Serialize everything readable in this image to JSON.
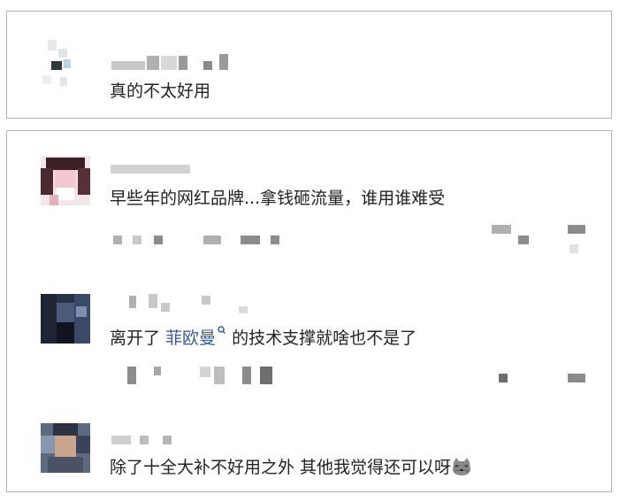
{
  "comments": [
    {
      "text": "真的不太好用"
    },
    {
      "text": "早些年的网红品牌...拿钱砸流量，谁用谁难受"
    },
    {
      "text_before": "离开了 ",
      "mention": "菲欧曼",
      "mention_icon": "search-icon",
      "text_after": " 的技术支撑就啥也不是了"
    },
    {
      "text": "除了十全大补不好用之外 其他我觉得还可以呀",
      "emoji": "cat-face-icon"
    }
  ],
  "colors": {
    "mention": "#3b5a9a",
    "text": "#222222",
    "border": "#b4b4b4"
  }
}
